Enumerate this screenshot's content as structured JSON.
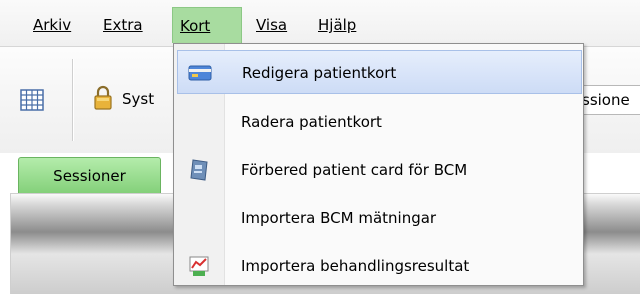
{
  "menubar": {
    "items": [
      {
        "label": "Arkiv",
        "active": false
      },
      {
        "label": "Extra",
        "active": false
      },
      {
        "label": "Kort",
        "active": true
      },
      {
        "label": "Visa",
        "active": false
      },
      {
        "label": "Hjälp",
        "active": false
      }
    ]
  },
  "toolbar": {
    "grid_icon": "grid-icon",
    "lock_icon": "lock-icon",
    "system_button_label": "Syst",
    "sessions_button_label": "ssione"
  },
  "tabs": [
    {
      "label": "Sessioner",
      "active": true
    }
  ],
  "kort_menu": {
    "items": [
      {
        "label": "Redigera patientkort",
        "icon": "card-icon",
        "selected": true
      },
      {
        "label": "Radera patientkort",
        "icon": "",
        "selected": false
      },
      {
        "label": "Förbered patient card för BCM",
        "icon": "patient-card-icon",
        "selected": false
      },
      {
        "label": "Importera BCM mätningar",
        "icon": "",
        "selected": false
      },
      {
        "label": "Importera behandlingsresultat",
        "icon": "import-results-icon",
        "selected": false
      }
    ]
  },
  "colors": {
    "menu_active_bg": "#a8dca0",
    "tab_active_bg": "#84d07a",
    "menu_highlight": "#cddcf6"
  }
}
